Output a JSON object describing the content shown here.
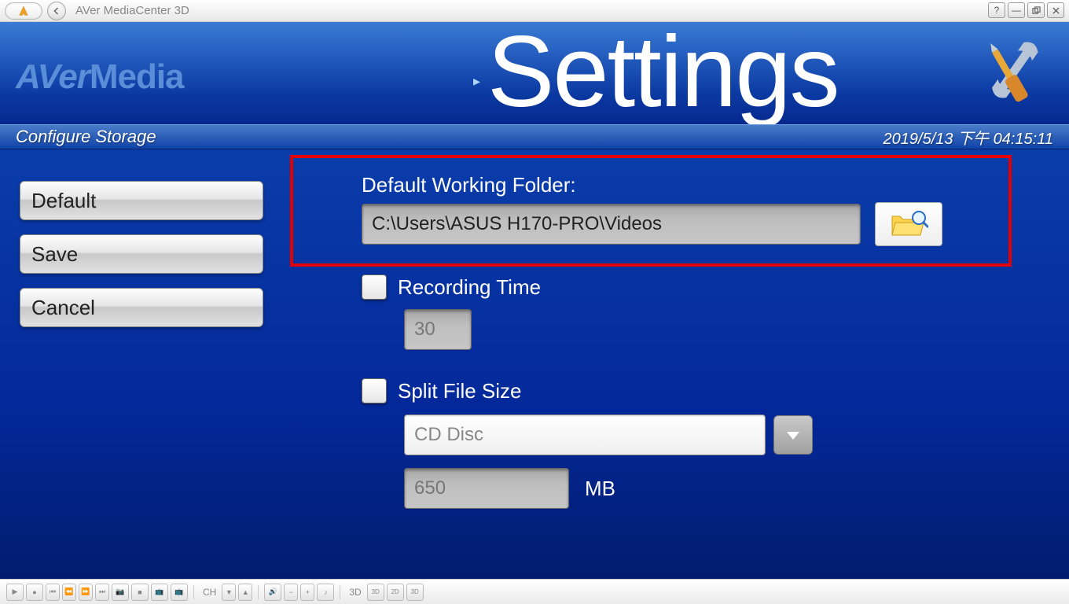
{
  "titlebar": {
    "title": "AVer MediaCenter 3D"
  },
  "header": {
    "brand_upper": "AVer",
    "brand_lower": "Media",
    "page_title": "Settings"
  },
  "subheader": {
    "breadcrumb": "Configure Storage",
    "timestamp": "2019/5/13 下午 04:15:11"
  },
  "sidebar": {
    "default_label": "Default",
    "save_label": "Save",
    "cancel_label": "Cancel"
  },
  "form": {
    "folder_label": "Default Working Folder:",
    "folder_value": "C:\\Users\\ASUS H170-PRO\\Videos",
    "recording_time_label": "Recording Time",
    "recording_time_value": "30",
    "split_file_label": "Split File Size",
    "split_file_option": "CD Disc",
    "split_file_size": "650",
    "size_unit": "MB"
  },
  "bottombar": {
    "ch_label": "CH",
    "threeD_label": "3D",
    "group3_labels": [
      "3D",
      "2D",
      "3D"
    ]
  }
}
